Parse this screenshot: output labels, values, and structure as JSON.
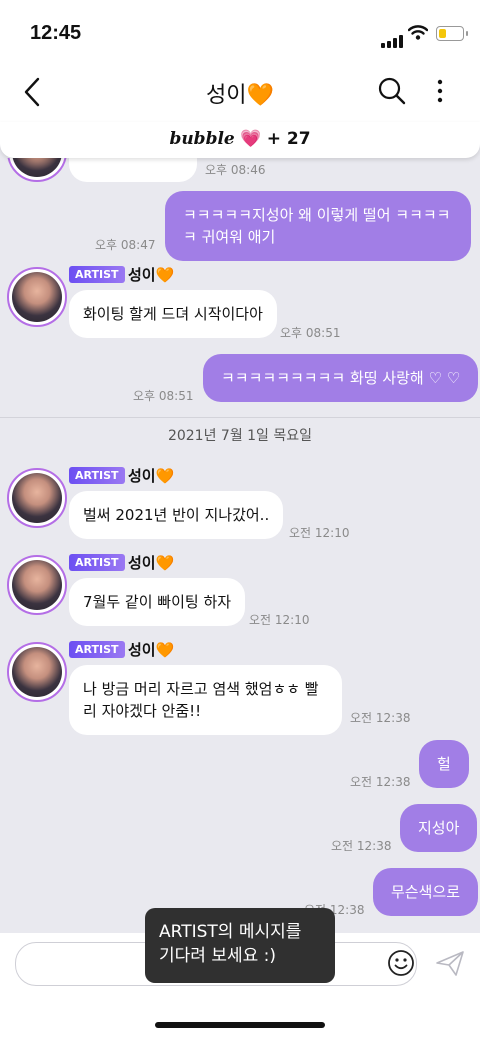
{
  "status": {
    "time": "12:45"
  },
  "header": {
    "title": "성이",
    "title_emoji": "🧡"
  },
  "banner": {
    "logo": "bubble",
    "heart": "💗",
    "count": "+ 27"
  },
  "messages": [
    {
      "text": "",
      "time": "오후 08:46"
    },
    {
      "text": "ㅋㅋㅋㅋㅋ지성아 왜 이렇게 떨어 ㅋㅋㅋㅋㅋ 귀여워 애기",
      "time": "오후 08:47"
    },
    {
      "badge": "ARTIST",
      "sender": "성이",
      "sender_emoji": "🧡",
      "text": "화이팅 할게 드뎌 시작이다아",
      "time": "오후 08:51"
    },
    {
      "text": "ㅋㅋㅋㅋㅋㅋㅋㅋㅋ 화띵 사랑해 ♡ ♡",
      "time": "오후 08:51"
    },
    {
      "badge": "ARTIST",
      "sender": "성이",
      "sender_emoji": "🧡",
      "text": "벌써 2021년 반이 지나갔어..",
      "time": "오전 12:10"
    },
    {
      "badge": "ARTIST",
      "sender": "성이",
      "sender_emoji": "🧡",
      "text": "7월두 같이 빠이팅 하자",
      "time": "오전 12:10"
    },
    {
      "badge": "ARTIST",
      "sender": "성이",
      "sender_emoji": "🧡",
      "text": "나 방금 머리 자르고 염색 했엄ㅎㅎ 빨리 자야겠다 안줌!!",
      "time": "오전 12:38"
    },
    {
      "text": "헐",
      "time": "오전 12:38"
    },
    {
      "text": "지성아",
      "time": "오전 12:38"
    },
    {
      "text": "무슨색으로",
      "time": "오전 12:38"
    }
  ],
  "date_divider": "2021년 7월 1일 목요일",
  "toast": "ARTIST의 메시지를 기다려 보세요 :)",
  "colors": {
    "accent": "#a17ee6",
    "chat_bg": "#e9e9ef",
    "orange_heart": "#f59a23",
    "pink_heart": "#e4558d"
  }
}
